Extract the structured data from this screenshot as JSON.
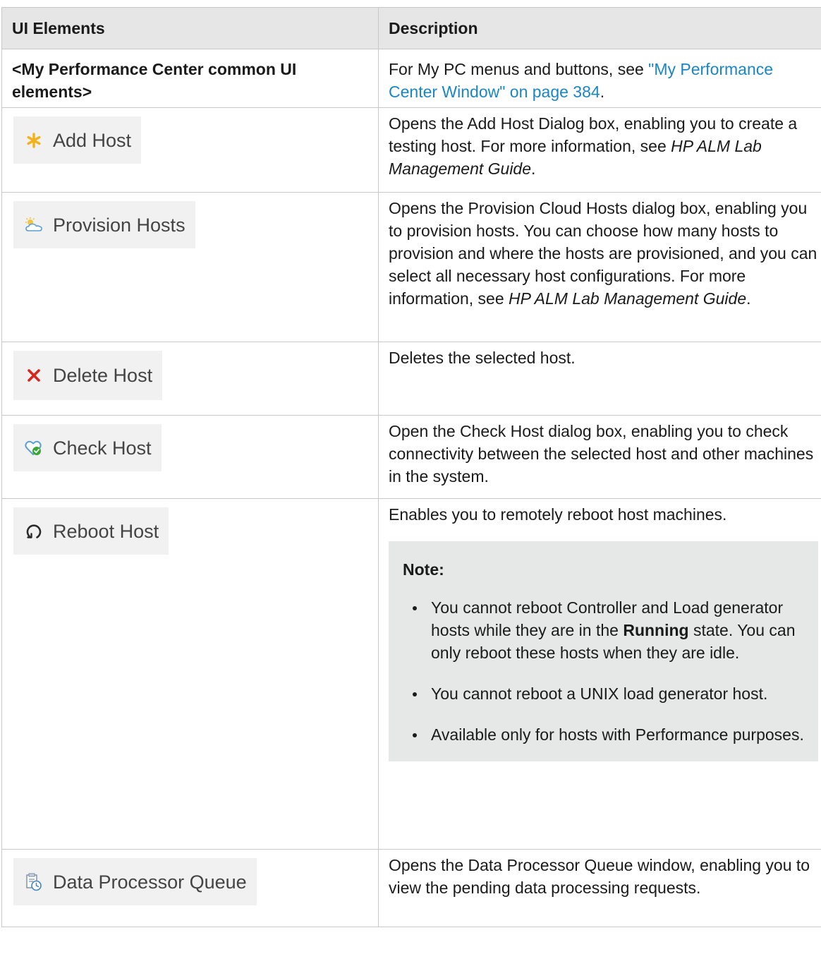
{
  "headers": {
    "col1": "UI Elements",
    "col2": "Description"
  },
  "row_common": {
    "label": "<My Performance Center common UI elements>",
    "desc_prefix": "For My PC menus and buttons, see ",
    "desc_link": "\"My Performance Center Window\" on page 384",
    "desc_suffix": "."
  },
  "row_add_host": {
    "button_label": "Add Host",
    "icon": "asterisk-icon",
    "desc_prefix": "Opens the Add Host Dialog box, enabling you to create a testing host. For more information, see ",
    "desc_italic": "HP ALM Lab Management Guide",
    "desc_suffix": "."
  },
  "row_provision": {
    "button_label": "Provision Hosts",
    "icon": "cloud-sun-icon",
    "desc_prefix": "Opens the Provision Cloud Hosts dialog box, enabling you to provision hosts. You can choose how many hosts to provision and where the hosts are provisioned, and you can select all necessary host configurations. For more information, see ",
    "desc_italic": "HP ALM Lab Management Guide",
    "desc_suffix": "."
  },
  "row_delete": {
    "button_label": "Delete Host",
    "icon": "delete-x-icon",
    "desc": "Deletes the selected host."
  },
  "row_check": {
    "button_label": "Check Host",
    "icon": "heart-check-icon",
    "desc": "Open the Check Host dialog box, enabling you to check connectivity between the selected host and other machines in the system."
  },
  "row_reboot": {
    "button_label": "Reboot Host",
    "icon": "refresh-icon",
    "desc": "Enables you to remotely reboot host machines.",
    "note_title": "Note:",
    "note_item1_prefix": "You cannot reboot Controller and Load generator hosts while they are in the ",
    "note_item1_bold": "Running",
    "note_item1_suffix": " state. You can only reboot these hosts when they are idle.",
    "note_item2": "You cannot reboot a UNIX load generator host.",
    "note_item3": "Available only for hosts with Performance purposes."
  },
  "row_queue": {
    "button_label": "Data Processor Queue",
    "icon": "queue-clock-icon",
    "desc": "Opens the Data Processor Queue window, enabling you to view the pending data processing requests."
  },
  "colors": {
    "header_bg": "#e6e6e6",
    "border": "#c8c8c8",
    "link": "#1a86c4",
    "button_bg": "#f1f1f1",
    "note_bg": "#e6e8e8"
  }
}
